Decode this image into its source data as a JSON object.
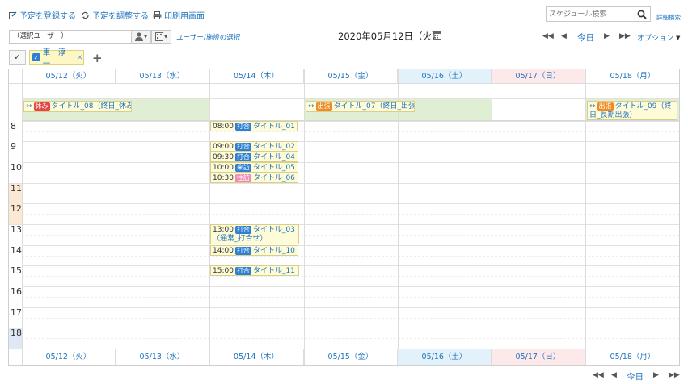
{
  "toolbar": {
    "register_label": "予定を登録する",
    "adjust_label": "予定を調整する",
    "print_label": "印刷用画面",
    "search_placeholder": "スケジュール検索",
    "detail_search_label": "詳細検索"
  },
  "selector": {
    "user_value": "（選択ユーザー）",
    "facility_link": "ユーザー/施設の選択"
  },
  "date_title": "2020年05月12日（火）",
  "nav": {
    "today_label": "今日",
    "option_label": "オプション"
  },
  "filter": {
    "chip_label": "車　淳一"
  },
  "days": [
    "05/12（火）",
    "05/13（水）",
    "05/14（木）",
    "05/15（金）",
    "05/16（土）",
    "05/17（日）",
    "05/18（月）"
  ],
  "hours": [
    "8",
    "9",
    "10",
    "11",
    "12",
    "13",
    "14",
    "15",
    "16",
    "17",
    "18"
  ],
  "allday_events": [
    {
      "tag": "休み",
      "title": "タイトル_08（終日_休み）"
    },
    {
      "tag": "出張",
      "title": "タイトル_07（終日_出張）"
    },
    {
      "tag": "出張",
      "title": "タイトル_09（終日_長期出張）"
    }
  ],
  "events": [
    {
      "time": "08:00",
      "tag": "打合",
      "title": "タイトル_01"
    },
    {
      "time": "09:00",
      "tag": "打合",
      "title": "タイトル_02"
    },
    {
      "time": "09:30",
      "tag": "打合",
      "title": "タイトル_04"
    },
    {
      "time": "10:00",
      "tag": "来訪",
      "title": "タイトル_05"
    },
    {
      "time": "10:30",
      "tag": "往訪",
      "title": "タイトル_06"
    },
    {
      "time": "13:00",
      "tag": "打合",
      "title": "タイトル_03",
      "note": "（通常_打合せ）"
    },
    {
      "time": "14:00",
      "tag": "打合",
      "title": "タイトル_10"
    },
    {
      "time": "15:00",
      "tag": "打合",
      "title": "タイトル_11"
    }
  ],
  "colors": {
    "accent": "#1e73be",
    "saturday_bg": "#e3f1fb",
    "sunday_bg": "#fde8ea",
    "allday_bg": "#e0efd4",
    "event_bg": "#fefbd8"
  }
}
